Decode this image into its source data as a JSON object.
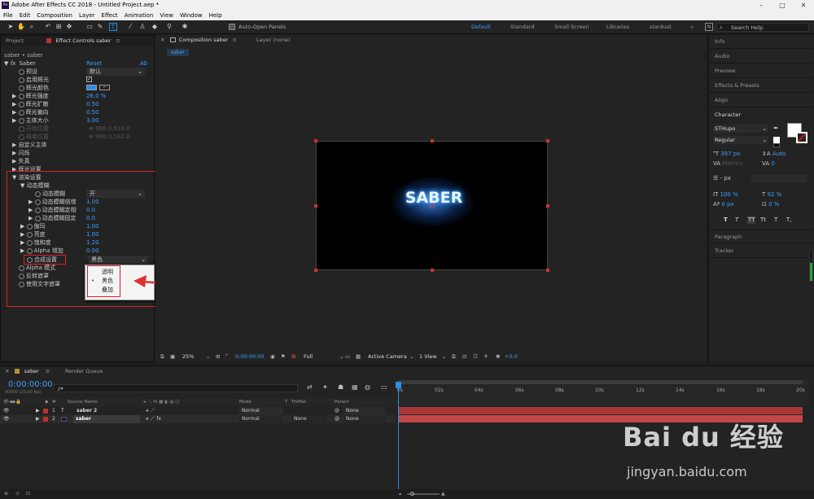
{
  "window": {
    "title": "Adobe After Effects CC 2018 - Untitled Project.aep *",
    "app_badge": "Ae"
  },
  "menu": [
    "File",
    "Edit",
    "Composition",
    "Layer",
    "Effect",
    "Animation",
    "View",
    "Window",
    "Help"
  ],
  "toolbar": {
    "auto_open_label": "Auto-Open Panels",
    "workspaces": [
      "Default",
      "Standard",
      "Small Screen",
      "Libraries",
      "stardust"
    ],
    "workspace_more": "»",
    "search_placeholder": "Search Help"
  },
  "left_panel": {
    "tabs": {
      "project": "Project",
      "effect_controls": "Effect Controls saber"
    },
    "breadcrumb": "saber • saber",
    "effect": {
      "name": "Saber",
      "reset": "Reset",
      "about": "Ab"
    },
    "props": [
      {
        "label": "预设",
        "value": "默认"
      },
      {
        "label": "启用辉光"
      },
      {
        "label": "辉光颜色"
      },
      {
        "label": "辉光强度",
        "value": "26.0 %"
      },
      {
        "label": "辉光扩散",
        "value": "0.50"
      },
      {
        "label": "辉光偏向",
        "value": "0.50"
      },
      {
        "label": "主体大小",
        "value": "3.00"
      },
      {
        "label": "开始位置",
        "value": "960.0,918.0"
      },
      {
        "label": "结束位置",
        "value": "960.0,162.0"
      },
      {
        "label": "自定义主体"
      },
      {
        "label": "闪烁"
      },
      {
        "label": "失真"
      },
      {
        "label": "辉光设置"
      }
    ],
    "render": {
      "title": "渲染设置",
      "motion_blur": "动态模糊",
      "items": [
        {
          "label": "动态模糊",
          "value": "开"
        },
        {
          "label": "动态模糊倍增",
          "value": "1.00"
        },
        {
          "label": "动态模糊定相",
          "value": "0.0"
        },
        {
          "label": "动态模糊固定",
          "value": "0.0"
        },
        {
          "label": "伽玛",
          "value": "1.00"
        },
        {
          "label": "亮度",
          "value": "1.00"
        },
        {
          "label": "饱和度",
          "value": "1.20"
        },
        {
          "label": "Alpha 增加",
          "value": "0.00"
        },
        {
          "label": "合成设置",
          "value": "黑色"
        },
        {
          "label": "Alpha 模式"
        },
        {
          "label": "反转遮罩"
        },
        {
          "label": "使用文字遮罩"
        }
      ]
    },
    "dropdown": {
      "options": [
        "透明",
        "黑色",
        "叠加"
      ],
      "selected": "黑色"
    }
  },
  "comp_panel": {
    "tab_label": "Composition saber",
    "layer_tab": "Layer (none)",
    "sub_tab": "saber",
    "canvas_text": "SABER",
    "footer": {
      "zoom": "25%",
      "timecode": "0:00:00:00",
      "quality": "Full",
      "camera": "Active Camera",
      "views": "1 View",
      "exposure": "+0.0"
    }
  },
  "right_panel": {
    "items": [
      "Info",
      "Audio",
      "Preview",
      "Effects & Presets",
      "Align"
    ],
    "character": {
      "title": "Character",
      "font": "STHupo",
      "style": "Regular",
      "size": "397 px",
      "leading": "Auto",
      "kerning": "Metrics",
      "tracking": "0",
      "stroke": "- px",
      "vscale": "100 %",
      "hscale": "92 %",
      "baseline": "0 px",
      "tsume": "0 %",
      "style_buttons": [
        "T",
        "T",
        "TT",
        "Tt",
        "T",
        "T,"
      ]
    },
    "paragraph": "Paragraph",
    "tracker": "Tracker"
  },
  "timeline": {
    "tabs": {
      "comp": "saber",
      "render": "Render Queue"
    },
    "timecode": "0:00:00:00",
    "fps": "00000 (25.00 fps)",
    "search_icon_label": "ρ▾",
    "columns": {
      "num": "#",
      "source": "Source Name",
      "mode": "Mode",
      "t": "T",
      "trkmat": "TrkMat",
      "parent": "Parent"
    },
    "layers": [
      {
        "num": "1",
        "type": "T",
        "name": "saber 2",
        "mode": "Normal",
        "trkmat": "",
        "parent": "None",
        "color": "#b83434"
      },
      {
        "num": "2",
        "type": "",
        "name": "saber",
        "mode": "Normal",
        "trkmat": "None",
        "parent": "None",
        "color": "#b83434"
      }
    ],
    "ruler": [
      "0s",
      "02s",
      "04s",
      "06s",
      "08s",
      "10s",
      "12s",
      "14s",
      "16s",
      "18s",
      "20s"
    ]
  },
  "watermark": {
    "brand": "Bai du 经验",
    "url": "jingyan.baidu.com"
  },
  "colors": {
    "accent": "#2d8ceb",
    "highlight": "#e02020",
    "glow": "#59b8ff"
  }
}
